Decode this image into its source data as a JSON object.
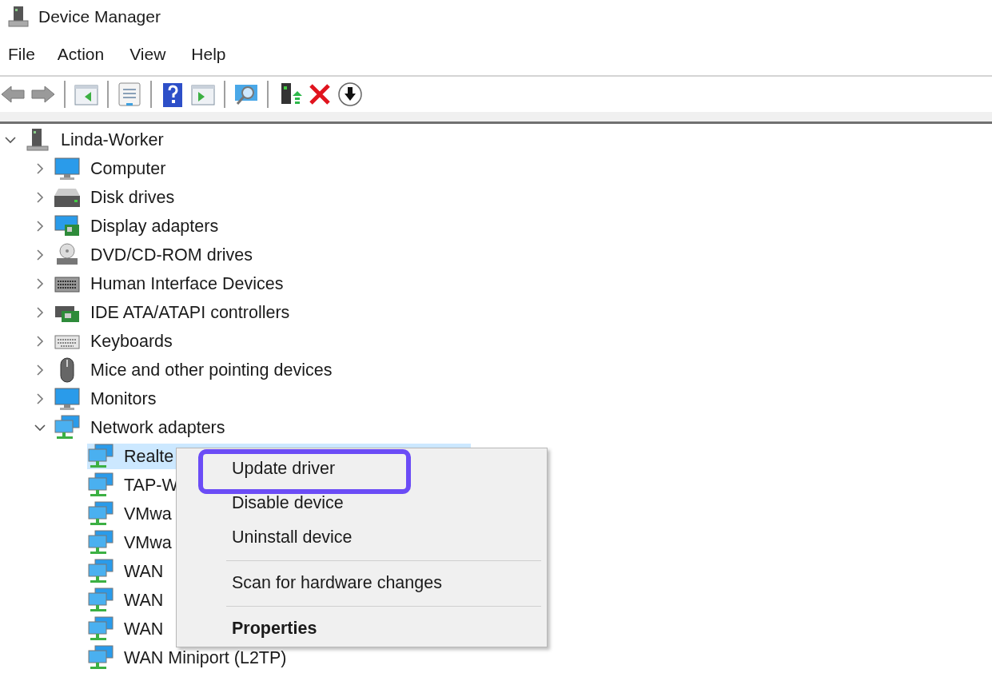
{
  "window": {
    "title": "Device Manager"
  },
  "menu": [
    "File",
    "Action",
    "View",
    "Help"
  ],
  "toolbar": [
    {
      "kind": "back"
    },
    {
      "kind": "forward"
    },
    {
      "kind": "sep"
    },
    {
      "kind": "pane-left"
    },
    {
      "kind": "sep"
    },
    {
      "kind": "properties"
    },
    {
      "kind": "sep"
    },
    {
      "kind": "help"
    },
    {
      "kind": "pane-right"
    },
    {
      "kind": "sep"
    },
    {
      "kind": "scan"
    },
    {
      "kind": "sep"
    },
    {
      "kind": "update"
    },
    {
      "kind": "remove"
    },
    {
      "kind": "down"
    }
  ],
  "tree": {
    "label": "Linda-Worker",
    "kind": "pc",
    "expanded": true,
    "children": [
      {
        "label": "Computer",
        "kind": "monitor",
        "expanded": false
      },
      {
        "label": "Disk drives",
        "kind": "disk",
        "expanded": false
      },
      {
        "label": "Display adapters",
        "kind": "display",
        "expanded": false
      },
      {
        "label": "DVD/CD-ROM drives",
        "kind": "dvd",
        "expanded": false
      },
      {
        "label": "Human Interface Devices",
        "kind": "hid",
        "expanded": false
      },
      {
        "label": "IDE ATA/ATAPI controllers",
        "kind": "ide",
        "expanded": false
      },
      {
        "label": "Keyboards",
        "kind": "keyboard",
        "expanded": false
      },
      {
        "label": "Mice and other pointing devices",
        "kind": "mouse",
        "expanded": false
      },
      {
        "label": "Monitors",
        "kind": "monitor",
        "expanded": false
      },
      {
        "label": "Network adapters",
        "kind": "network",
        "expanded": true,
        "children": [
          {
            "label": "Realte",
            "kind": "network",
            "selected": true
          },
          {
            "label": "TAP-W",
            "kind": "network",
            "selected": false
          },
          {
            "label": "VMwa",
            "kind": "network",
            "selected": false
          },
          {
            "label": "VMwa",
            "kind": "network",
            "selected": false
          },
          {
            "label": "WAN",
            "kind": "network",
            "selected": false
          },
          {
            "label": "WAN",
            "kind": "network",
            "selected": false
          },
          {
            "label": "WAN",
            "kind": "network",
            "selected": false
          },
          {
            "label": "WAN Miniport (L2TP)",
            "kind": "network",
            "selected": false
          }
        ]
      }
    ]
  },
  "context_menu": [
    {
      "kind": "item",
      "label": "Update driver",
      "highlighted": true,
      "bold": false
    },
    {
      "kind": "item",
      "label": "Disable device",
      "highlighted": false,
      "bold": false
    },
    {
      "kind": "item",
      "label": "Uninstall device",
      "highlighted": false,
      "bold": false
    },
    {
      "kind": "divider"
    },
    {
      "kind": "item",
      "label": "Scan for hardware changes",
      "highlighted": false,
      "bold": false
    },
    {
      "kind": "divider"
    },
    {
      "kind": "item",
      "label": "Properties",
      "highlighted": false,
      "bold": true
    }
  ]
}
